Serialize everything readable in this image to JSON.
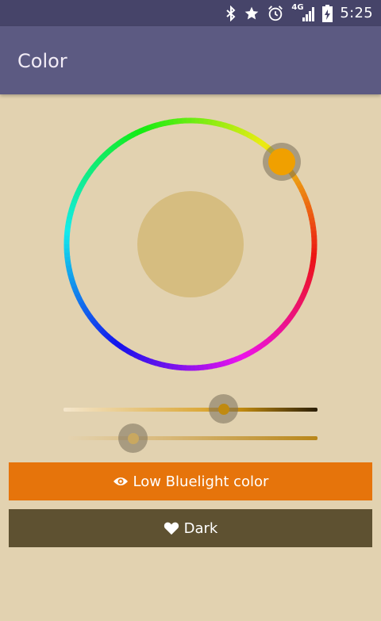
{
  "status_bar": {
    "time": "5:25",
    "network_label": "4G",
    "icons": [
      "bluetooth-icon",
      "star-icon",
      "alarm-icon",
      "signal-icon",
      "battery-charging-icon"
    ]
  },
  "app_bar": {
    "title": "Color"
  },
  "color_wheel": {
    "selected_color": "#f0a000",
    "preview_color": "#d6bd80",
    "handle_hue_position": "upper-right"
  },
  "sliders": {
    "brightness": {
      "value": 0.63,
      "thumb_color": "#c08a10"
    },
    "intensity": {
      "value": 0.26,
      "thumb_color": "#c9a860"
    }
  },
  "buttons": {
    "low_bluelight": {
      "label": "Low Bluelight color",
      "icon": "eye-icon",
      "color": "#e6740b"
    },
    "dark": {
      "label": "Dark",
      "icon": "heart-icon",
      "color": "#5e5131"
    }
  },
  "colors": {
    "background": "#e2d2b0",
    "status_bar": "#464469",
    "app_bar": "#5c5a82"
  }
}
